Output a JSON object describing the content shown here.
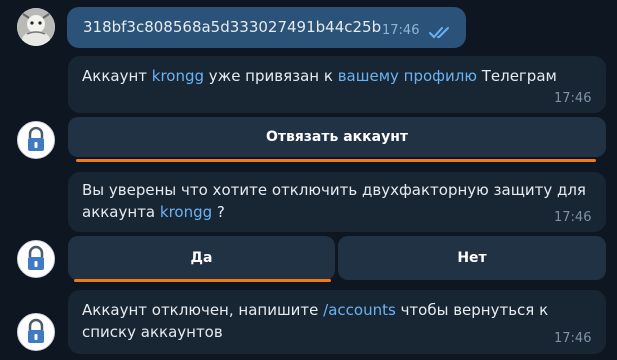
{
  "messages": {
    "outgoing": {
      "text": "318bf3c808568a5d333027491b44c25b",
      "time": "17:46"
    },
    "linked": {
      "text_prefix": "Аккаунт ",
      "account": "krongg",
      "text_middle": " уже привязан к ",
      "profile_link": "вашему профилю",
      "text_suffix": " Телеграм",
      "time": "17:46",
      "button": "Отвязать аккаунт"
    },
    "confirm": {
      "line1": "Вы уверены что хотите отключить двухфакторную защиту для",
      "line2_prefix": "аккаунта ",
      "account": "krongg",
      "line2_suffix": " ?",
      "time": "17:46",
      "buttons": {
        "yes": "Да",
        "no": "Нет"
      }
    },
    "disabled": {
      "line1_prefix": "Аккаунт отключен, напишите ",
      "command": "/accounts",
      "line1_suffix": " чтобы вернуться к",
      "line2": "списку аккаунтов",
      "time": "17:46"
    }
  },
  "colors": {
    "background": "#0e1621",
    "incoming_bubble": "#182533",
    "outgoing_bubble": "#2b5278",
    "link": "#6ab3f3",
    "highlight_underline": "#f07b16"
  },
  "icons": {
    "user_avatar": "user-photo-avatar",
    "bot_avatar": "lock-icon",
    "read_status": "double-check-icon"
  }
}
